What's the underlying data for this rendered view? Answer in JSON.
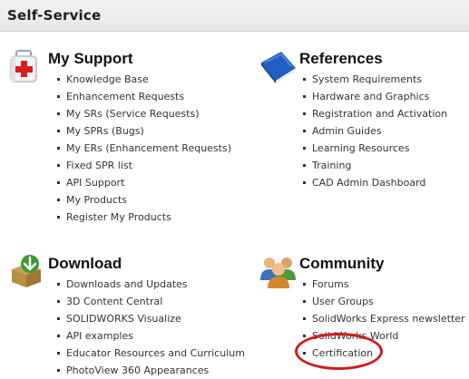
{
  "page": {
    "title": "Self-Service"
  },
  "sections": {
    "my_support": {
      "title": "My Support",
      "icon": "first-aid-kit-icon",
      "links": [
        "Knowledge Base",
        "Enhancement Requests",
        "My SRs (Service Requests)",
        "My SPRs (Bugs)",
        "My ERs (Enhancement Requests)",
        "Fixed SPR list",
        "API Support",
        "My Products",
        "Register My Products"
      ]
    },
    "references": {
      "title": "References",
      "icon": "blue-book-icon",
      "links": [
        "System Requirements",
        "Hardware and Graphics",
        "Registration and Activation",
        "Admin Guides",
        "Learning Resources",
        "Training",
        "CAD Admin Dashboard"
      ]
    },
    "download": {
      "title": "Download",
      "icon": "download-box-icon",
      "links": [
        "Downloads and Updates",
        "3D Content Central",
        "SOLIDWORKS Visualize",
        "API examples",
        "Educator Resources and Curriculum",
        "PhotoView 360 Appearances"
      ]
    },
    "community": {
      "title": "Community",
      "icon": "people-group-icon",
      "links": [
        "Forums",
        "User Groups",
        "SolidWorks Express newsletter",
        "SolidWorks World",
        "Certification"
      ]
    }
  },
  "annotation": {
    "color": "#d01c1c",
    "target": "Certification"
  },
  "colors": {
    "accent_red": "#d01c1c",
    "link_text": "#333333",
    "header_bg": "#ececec"
  }
}
